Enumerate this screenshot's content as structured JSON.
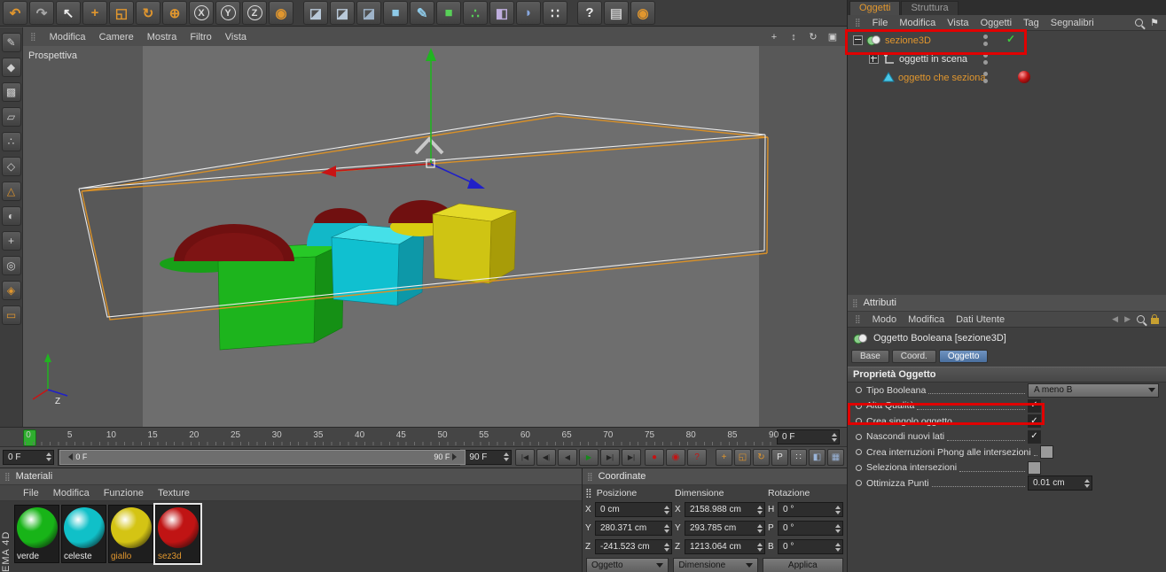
{
  "colors": {
    "accent_orange": "#e0962e",
    "annotation_red": "#e10000",
    "active_tab_blue": "#4a6f9e",
    "viewport_bg": "#585858"
  },
  "icons": {
    "grip": "⣿",
    "check": "✓",
    "flag": "⚑",
    "menu_back": "◀",
    "menu_fwd": "▶",
    "pan_view": "+",
    "zoom_view": "↕",
    "rotate_view": "↻",
    "toggle_view": "▣"
  },
  "top_toolbar": {
    "icons": [
      {
        "name": "undo-icon",
        "glyph": "↶",
        "fg": "#e0962e"
      },
      {
        "name": "redo-icon",
        "glyph": "↷",
        "fg": "#a8a8a8"
      },
      {
        "name": "select-tool-icon",
        "glyph": "↖",
        "fg": "#ececec"
      },
      {
        "name": "move-tool-icon",
        "glyph": "+",
        "fg": "#e0962e"
      },
      {
        "name": "scale-tool-icon",
        "glyph": "◱",
        "fg": "#e0962e"
      },
      {
        "name": "rotate-tool-icon",
        "glyph": "↻",
        "fg": "#e0962e"
      },
      {
        "name": "last-tool-icon",
        "glyph": "⊕",
        "fg": "#e0962e"
      },
      {
        "name": "lock-x-axis-icon",
        "glyph": "X",
        "fg": "#d8d8d8",
        "circled": true
      },
      {
        "name": "lock-y-axis-icon",
        "glyph": "Y",
        "fg": "#d8d8d8",
        "circled": true
      },
      {
        "name": "lock-z-axis-icon",
        "glyph": "Z",
        "fg": "#d8d8d8",
        "circled": true
      },
      {
        "name": "coordinate-system-icon",
        "glyph": "◉",
        "fg": "#e0962e"
      },
      {
        "separator": true
      },
      {
        "name": "render-view-icon",
        "glyph": "◪",
        "fg": "#b9c9d9"
      },
      {
        "name": "render-region-icon",
        "glyph": "◪",
        "fg": "#b9c9d9"
      },
      {
        "name": "render-settings-icon",
        "glyph": "◪",
        "fg": "#9fb4c9"
      },
      {
        "name": "primitive-cube-icon",
        "glyph": "■",
        "fg": "#8ecae8"
      },
      {
        "name": "spline-pen-icon",
        "glyph": "✎",
        "fg": "#8ecae8"
      },
      {
        "name": "subdivision-surface-icon",
        "glyph": "■",
        "fg": "#58d058"
      },
      {
        "name": "array-object-icon",
        "glyph": "∴",
        "fg": "#58d058"
      },
      {
        "name": "deformer-icon",
        "glyph": "◧",
        "fg": "#bfaede"
      },
      {
        "name": "floor-sky-icon",
        "glyph": "◗",
        "fg": "#88a8e0"
      },
      {
        "name": "particles-icon",
        "glyph": "∷",
        "fg": "#e4e4e4"
      },
      {
        "separator": true
      },
      {
        "name": "help-cursor-icon",
        "glyph": "?",
        "fg": "#ececec"
      },
      {
        "name": "display-filter-icon",
        "glyph": "▤",
        "fg": "#c8c8c8"
      },
      {
        "name": "texture-globe-icon",
        "glyph": "◉",
        "fg": "#e0962e"
      }
    ]
  },
  "left_toolbar": {
    "icons": [
      {
        "name": "make-editable-icon",
        "glyph": "✎",
        "fg": "#cfcfcf"
      },
      {
        "name": "model-mode-icon",
        "glyph": "◆",
        "fg": "#cfcfcf"
      },
      {
        "name": "texture-mode-icon",
        "glyph": "▩",
        "fg": "#cfcfcf"
      },
      {
        "name": "workplane-mode-icon",
        "glyph": "▱",
        "fg": "#cfcfcf"
      },
      {
        "name": "points-mode-icon",
        "glyph": "∴",
        "fg": "#cfcfcf"
      },
      {
        "name": "edges-mode-icon",
        "glyph": "◇",
        "fg": "#cfcfcf"
      },
      {
        "name": "polygons-mode-icon",
        "glyph": "△",
        "fg": "#e0962e"
      },
      {
        "name": "animation-mode-icon",
        "glyph": "◐",
        "fg": "#cfcfcf"
      },
      {
        "name": "enable-axis-icon",
        "glyph": "+",
        "fg": "#cfcfcf"
      },
      {
        "name": "viewport-solo-icon",
        "glyph": "◎",
        "fg": "#cfcfcf"
      },
      {
        "name": "snap-icon",
        "glyph": "◈",
        "fg": "#e0962e"
      },
      {
        "name": "axis-lock-icon",
        "glyph": "▭",
        "fg": "#e0962e"
      }
    ]
  },
  "viewport": {
    "menu": [
      "Modifica",
      "Camere",
      "Mostra",
      "Filtro",
      "Vista"
    ],
    "view_label": "Prospettiva",
    "axis_z_label": "Z"
  },
  "timeline": {
    "ticks": [
      "0",
      "5",
      "10",
      "15",
      "20",
      "25",
      "30",
      "35",
      "40",
      "45",
      "50",
      "55",
      "60",
      "65",
      "70",
      "75",
      "80",
      "85",
      "90"
    ],
    "ruler_end_box": "0 F",
    "current_frame_box": "0 F",
    "range_handle_start": "0 F",
    "range_handle_end": "90 F",
    "end_range_box": "90 F",
    "transport": [
      {
        "name": "goto-start-button",
        "glyph": "|◀",
        "fg": "#232323"
      },
      {
        "name": "prev-key-button",
        "glyph": "◀|",
        "fg": "#232323"
      },
      {
        "name": "prev-frame-button",
        "glyph": "◀",
        "fg": "#232323"
      },
      {
        "name": "play-button",
        "glyph": "▶",
        "fg": "#17881c"
      },
      {
        "name": "next-frame-button",
        "glyph": "▶|",
        "fg": "#232323"
      },
      {
        "name": "goto-end-button",
        "glyph": "▶|",
        "fg": "#232323"
      }
    ],
    "record": [
      {
        "name": "record-active-objects-button",
        "glyph": "●",
        "fg": "#c41414"
      },
      {
        "name": "autokeying-button",
        "glyph": "◉",
        "fg": "#c41414"
      },
      {
        "name": "keyframe-selection-button",
        "glyph": "?",
        "fg": "#c41414"
      }
    ],
    "key_toggles": [
      {
        "name": "position-key-toggle",
        "glyph": "+",
        "fg": "#e0962e"
      },
      {
        "name": "scale-key-toggle",
        "glyph": "◱",
        "fg": "#e0962e"
      },
      {
        "name": "rotation-key-toggle",
        "glyph": "↻",
        "fg": "#e0962e"
      },
      {
        "name": "parameter-key-toggle",
        "glyph": "P",
        "fg": "#e4e4e4"
      },
      {
        "name": "point-level-animation-toggle",
        "glyph": "∷",
        "fg": "#e4e4e4"
      },
      {
        "name": "keyframe-presets-icon",
        "glyph": "◧",
        "fg": "#9ab4d8"
      },
      {
        "name": "minimal-timeline-icon",
        "glyph": "▦",
        "fg": "#9ab4d8"
      }
    ]
  },
  "materials": {
    "title": "Materiali",
    "menu": [
      "File",
      "Modifica",
      "Funzione",
      "Texture"
    ],
    "items": [
      {
        "name": "verde",
        "color": "#18b418",
        "label_color": "#e8e8e8",
        "selected": false
      },
      {
        "name": "celeste",
        "color": "#10c0c8",
        "label_color": "#e8e8e8",
        "selected": false
      },
      {
        "name": "giallo",
        "color": "#d4c414",
        "label_color": "#e0962e",
        "selected": false
      },
      {
        "name": "sez3d",
        "color": "#c01414",
        "label_color": "#e0962e",
        "selected": true
      }
    ],
    "vertical_label": "EMA 4D"
  },
  "coordinates": {
    "title": "Coordinate",
    "groups": [
      {
        "header": "Posizione",
        "axes": [
          "X",
          "Y",
          "Z"
        ],
        "values": [
          "0 cm",
          "280.371 cm",
          "-241.523 cm"
        ]
      },
      {
        "header": "Dimensione",
        "axes": [
          "X",
          "Y",
          "Z"
        ],
        "values": [
          "2158.988 cm",
          "293.785 cm",
          "1213.064 cm"
        ]
      },
      {
        "header": "Rotazione",
        "axes": [
          "H",
          "P",
          "B"
        ],
        "values": [
          "0 °",
          "0 °",
          "0 °"
        ]
      }
    ],
    "footer": {
      "left_dropdown": "Oggetto",
      "mid_dropdown": "Dimensione",
      "apply": "Applica"
    }
  },
  "object_manager": {
    "tabs": [
      {
        "label": "Oggetti"
      },
      {
        "label": "Struttura"
      }
    ],
    "menu": [
      "File",
      "Modifica",
      "Vista",
      "Oggetti",
      "Tag",
      "Segnalibri"
    ],
    "tree": [
      {
        "label": "sezione3D"
      },
      {
        "label": "oggetti in scena"
      },
      {
        "label": "oggetto che seziona"
      }
    ]
  },
  "attributes": {
    "title": "Attributi",
    "menu": [
      "Modo",
      "Modifica",
      "Dati Utente"
    ],
    "object_title": "Oggetto Booleana [sezione3D]",
    "tabs": [
      "Base",
      "Coord.",
      "Oggetto"
    ],
    "section": "Proprietà Oggetto",
    "rows": [
      {
        "label": "Tipo Booleana",
        "value": "A meno B"
      },
      {
        "label": "Alta Qualità",
        "checked": true
      },
      {
        "label": "Crea singolo oggetto",
        "checked": true
      },
      {
        "label": "Nascondi nuovi lati",
        "checked": true
      },
      {
        "label": "Crea interruzioni Phong alle intersezioni",
        "checked": false
      },
      {
        "label": "Seleziona intersezioni",
        "checked": false
      },
      {
        "label": "Ottimizza Punti",
        "value": "0.01 cm"
      }
    ]
  }
}
